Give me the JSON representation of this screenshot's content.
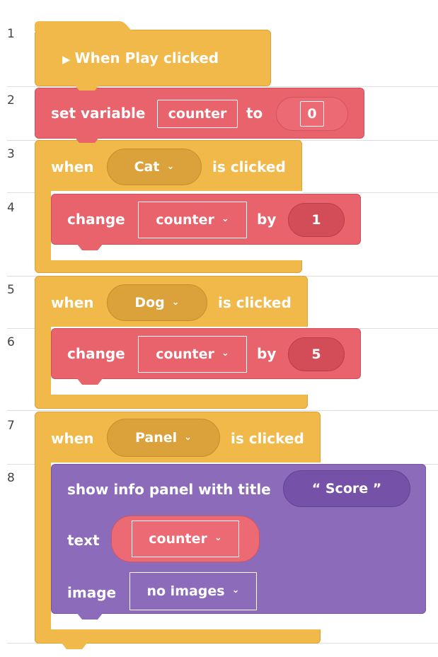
{
  "line_numbers": [
    "1",
    "2",
    "3",
    "4",
    "5",
    "6",
    "7",
    "8"
  ],
  "hat": {
    "play_icon": "play-triangle-icon",
    "label": "When Play clicked"
  },
  "set_var": {
    "prefix": "set variable",
    "var": "counter",
    "to": "to",
    "value": "0"
  },
  "events": [
    {
      "when": "when",
      "sprite": "Cat",
      "suffix": "is clicked"
    },
    {
      "when": "when",
      "sprite": "Dog",
      "suffix": "is clicked"
    },
    {
      "when": "when",
      "sprite": "Panel",
      "suffix": "is clicked"
    }
  ],
  "changes": [
    {
      "label": "change",
      "var": "counter",
      "by": "by",
      "amount": "1"
    },
    {
      "label": "change",
      "var": "counter",
      "by": "by",
      "amount": "5"
    }
  ],
  "info_panel": {
    "title_label": "show info panel with title",
    "title_value": "“  Score  ”",
    "text_label": "text",
    "text_value": "counter",
    "image_label": "image",
    "image_value": "no images"
  },
  "colors": {
    "event_yellow": "#f1b84a",
    "variable_red": "#e8636c",
    "looks_purple": "#8c6bbb"
  }
}
